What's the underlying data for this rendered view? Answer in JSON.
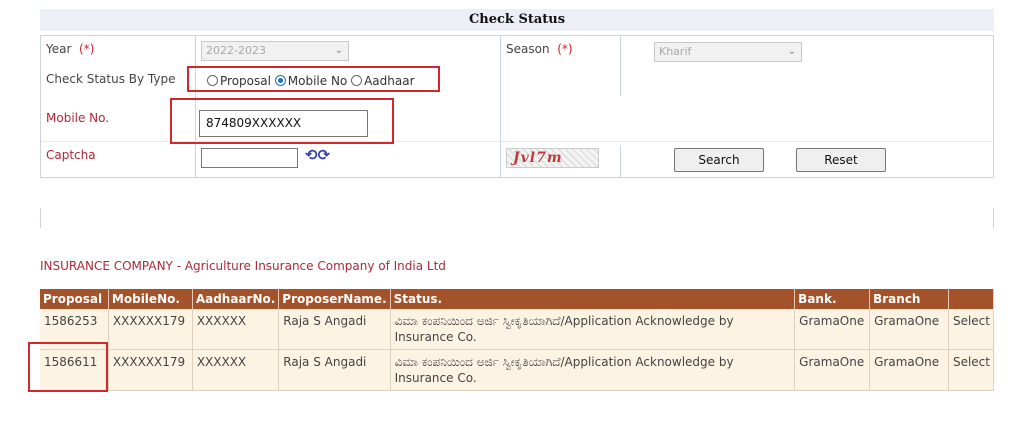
{
  "page_title": "Check Status",
  "form": {
    "year_label": "Year",
    "year_req": "(*)",
    "year_value": "2022-2023",
    "season_label": "Season",
    "season_req": "(*)",
    "season_value": "Kharif",
    "check_by_label": "Check Status By Type",
    "check_options": [
      "Proposal",
      "Mobile No",
      "Aadhaar"
    ],
    "check_selected": "Mobile No",
    "mobile_label": "Mobile No.",
    "mobile_value": "874809XXXXXX",
    "captcha_label": "Captcha",
    "captcha_input_value": "",
    "captcha_text": "Jvl7m",
    "search_button": "Search",
    "reset_button": "Reset"
  },
  "insurance_line": "INSURANCE COMPANY - Agriculture Insurance Company of India Ltd",
  "table": {
    "headers": [
      "Proposal",
      "MobileNo.",
      "AadhaarNo.",
      "ProposerName.",
      "Status.",
      "Bank.",
      "Branch",
      ""
    ],
    "rows": [
      [
        "1586253",
        "XXXXXX179",
        "XXXXXX",
        "Raja S Angadi",
        "ವಿಮಾ ಕಂಪನಿಯಿಂದ ಅರ್ಜಿ ಸ್ವೀಕೃತಿಯಾಗಿದೆ/Application Acknowledge by Insurance Co.",
        "GramaOne",
        "GramaOne",
        "Select"
      ],
      [
        "1586611",
        "XXXXXX179",
        "XXXXXX",
        "Raja S Angadi",
        "ವಿಮಾ ಕಂಪನಿಯಿಂದ ಅರ್ಜಿ ಸ್ವೀಕೃತಿಯಾಗಿದೆ/Application Acknowledge by Insurance Co.",
        "GramaOne",
        "GramaOne",
        "Select"
      ]
    ]
  },
  "colors": {
    "header_bg": "#a3522a",
    "row_bg": "#fdf3e3",
    "highlight": "#d0282e",
    "label_red": "#b0283a"
  }
}
